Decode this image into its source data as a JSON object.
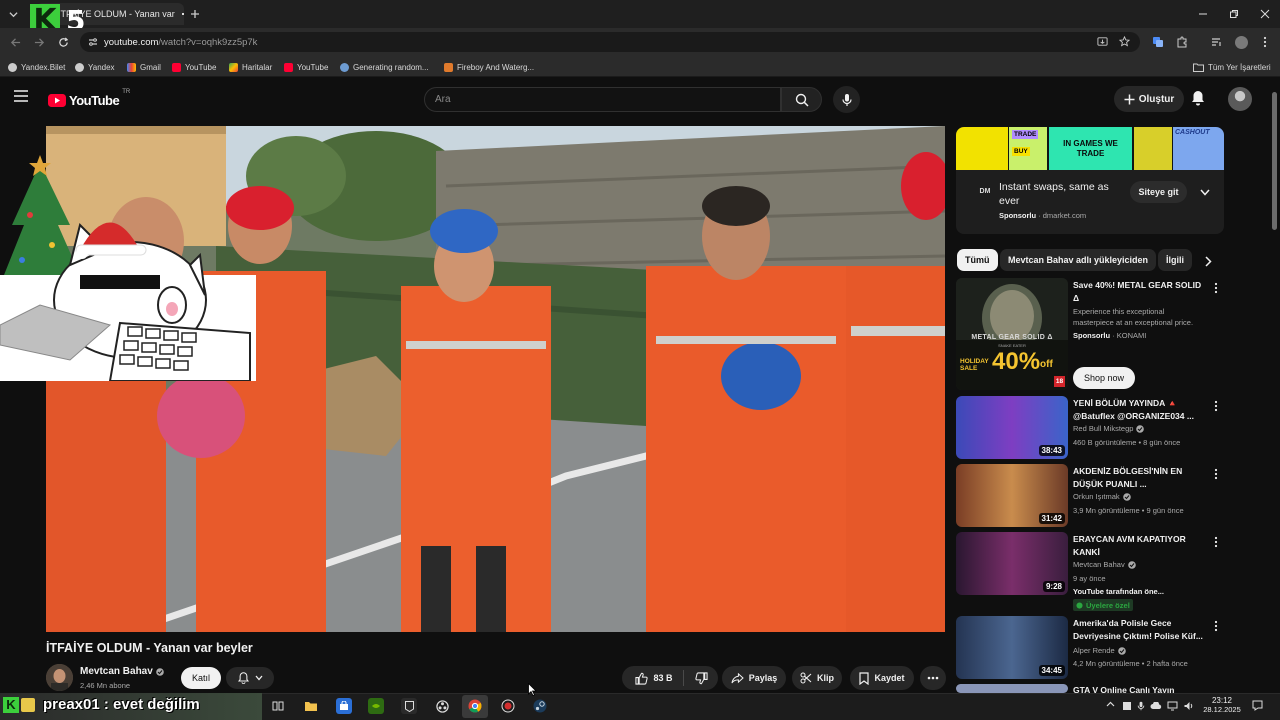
{
  "browser": {
    "tab_title": "İTFAİYE OLDUM - Yanan var",
    "url_host": "youtube.com",
    "url_path": "/watch?v=oqhk9zz5p7k",
    "bookmarks": [
      {
        "label": "Yandex.Bilet",
        "icon": "yandex-bilet-icon"
      },
      {
        "label": "Yandex",
        "icon": "yandex-icon"
      },
      {
        "label": "Gmail",
        "icon": "gmail-icon"
      },
      {
        "label": "YouTube",
        "icon": "youtube-icon"
      },
      {
        "label": "Haritalar",
        "icon": "maps-icon"
      },
      {
        "label": "YouTube",
        "icon": "youtube-icon"
      },
      {
        "label": "Generating random...",
        "icon": "globe-icon"
      },
      {
        "label": "Fireboy And Waterg...",
        "icon": "game-icon"
      }
    ],
    "all_bookmarks": "Tüm Yer İşaretleri"
  },
  "overlay": {
    "logo_k": "K",
    "logo_5": "5"
  },
  "youtube": {
    "logo_text": "YouTube",
    "logo_region": "TR",
    "search_placeholder": "Ara",
    "create_label": "Oluştur"
  },
  "video": {
    "title": "İTFAİYE OLDUM - Yanan var beyler",
    "channel": "Mevtcan Bahav",
    "subscribers": "2,46 Mn abone",
    "join_label": "Katıl",
    "likes": "83 B",
    "share_label": "Paylaş",
    "clip_label": "Klip",
    "save_label": "Kaydet"
  },
  "ad": {
    "banner_texts": [
      "TRADE",
      "BUY",
      "IN GAMES WE TRADE",
      "CASHOUT"
    ],
    "brand": "DM",
    "headline": "Instant swaps, same as ever",
    "sponsored": "Sponsorlu",
    "domain": "dmarket.com",
    "cta": "Siteye git"
  },
  "chips": [
    "Tümü",
    "Mevtcan Bahav adlı yükleyiciden",
    "İlgili"
  ],
  "related": [
    {
      "title": "Save 40%! METAL GEAR SOLID Δ",
      "description": "Experience this exceptional masterpiece at an exceptional price.",
      "sponsored": "Sponsorlu",
      "advertiser": "KONAMI",
      "cta": "Shop now",
      "sale_text": "40%",
      "sale_suffix": "off",
      "holiday": "HOLIDAY SALE",
      "game_title": "METAL GEAR SOLID Δ",
      "game_subtitle": "SNAKE EATER",
      "rating": "18"
    },
    {
      "title": "YENİ BÖLÜM YAYINDA 🔺 @Batuflex @ORGANIZE034 ...",
      "channel": "Red Bull Mikstegp",
      "stats": "460 B görüntüleme • 8 gün önce",
      "duration": "38:43"
    },
    {
      "title": "AKDENİZ BÖLGESİ'NİN EN DÜŞÜK PUANLI ...",
      "channel": "Orkun Işıtmak",
      "stats": "3,9 Mn görüntüleme • 9 gün önce",
      "duration": "31:42"
    },
    {
      "title": "ERAYCAN AVM KAPATIYOR KANKİ",
      "channel": "Mevtcan Bahav",
      "stats": "9 ay önce",
      "extra": "YouTube tarafından öne...",
      "badge": "Üyelere özel",
      "duration": "9:28"
    },
    {
      "title": "Amerika'da Polisle Gece Devriyesine Çıktım! Polise Küf...",
      "channel": "Alper Rende",
      "stats": "4,2 Mn görüntüleme • 2 hafta önce",
      "duration": "34:45"
    },
    {
      "title": "GTA V Online Canlı Yayın"
    }
  ],
  "stream_overlay": {
    "chat_line": "preax01 : evet değilim"
  },
  "taskbar": {
    "time": "23:12",
    "date": "28.12.2025"
  },
  "colors": {
    "page_bg": "#0f0f0f",
    "youtube_red": "#ff0033",
    "overlay_green": "#3ccf3c",
    "member_badge_green": "#2ba640"
  }
}
